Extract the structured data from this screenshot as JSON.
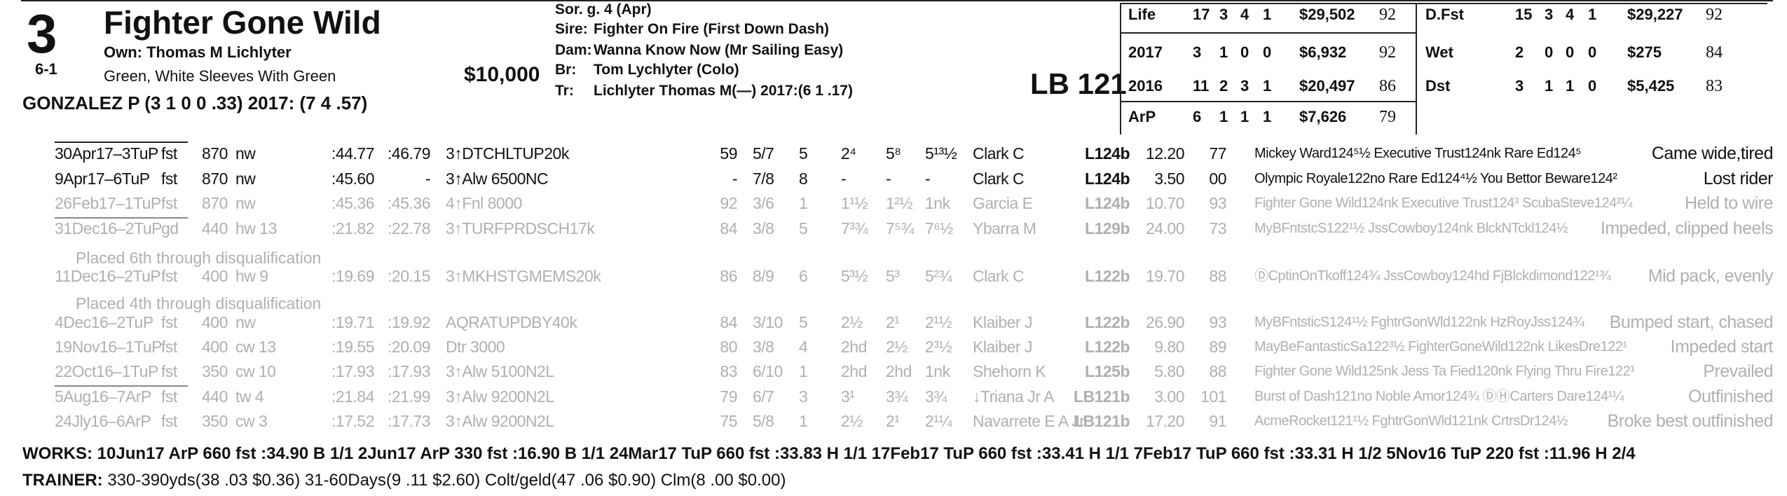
{
  "header": {
    "pp_number": "3",
    "horse_name": "Fighter Gone Wild",
    "owner": "Own: Thomas M Lichlyter",
    "morning_line": "6-1",
    "silks": "Green, White Sleeves With Green",
    "price": "$10,000",
    "jockey": "GONZALEZ P (3 1 0 0 .33) 2017: (7 4 .57)",
    "sex_age": "Sor. g. 4 (Apr)",
    "sire_label": "Sire:",
    "sire": "Fighter On Fire (First Down Dash)",
    "dam_label": "Dam:",
    "dam": "Wanna Know Now (Mr Sailing Easy)",
    "breeder_label": "Br:",
    "breeder": "Tom Lychlyter (Colo)",
    "trainer_label": "Tr:",
    "trainer": "Lichlyter Thomas M(—) 2017:(6 1 .17)",
    "lb": "LB 121"
  },
  "stats_left": [
    {
      "label": "Life",
      "starts": "17",
      "w": "3",
      "p": "4",
      "s": "1",
      "earn": "$29,502",
      "speed": "92"
    },
    {
      "label": "2017",
      "starts": "3",
      "w": "1",
      "p": "0",
      "s": "0",
      "earn": "$6,932",
      "speed": "92"
    },
    {
      "label": "2016",
      "starts": "11",
      "w": "2",
      "p": "3",
      "s": "1",
      "earn": "$20,497",
      "speed": "86"
    },
    {
      "label": "ArP",
      "starts": "6",
      "w": "1",
      "p": "1",
      "s": "1",
      "earn": "$7,626",
      "speed": "79"
    }
  ],
  "stats_right": [
    {
      "label": "D.Fst",
      "starts": "15",
      "w": "3",
      "p": "4",
      "s": "1",
      "earn": "$29,227",
      "speed": "92"
    },
    {
      "label": "Wet",
      "starts": "2",
      "w": "0",
      "p": "0",
      "s": "0",
      "earn": "$275",
      "speed": "84"
    },
    {
      "label": "Dst",
      "starts": "3",
      "w": "1",
      "p": "1",
      "s": "0",
      "earn": "$5,425",
      "speed": "83"
    }
  ],
  "races": [
    {
      "date": "30Apr17–3TuP",
      "cond": "fst",
      "dist": "870",
      "surf": "nw",
      "f1": ":44.77",
      "f2": ":46.79",
      "race": "3↑DTCHLTUP20k",
      "sp": "59",
      "pp": "5/7",
      "st": "5",
      "c1": "2⁴",
      "c2": "5⁸",
      "fin": "5¹³½",
      "jock": "Clark C",
      "wt": "L124b",
      "odds": "12.20",
      "fig": "77",
      "comment": "Mickey Ward124⁵½ Executive Trust124nk Rare Ed124⁵",
      "remark": "Came wide,tired",
      "faded": false
    },
    {
      "date": "9Apr17–6TuP",
      "cond": "fst",
      "dist": "870",
      "surf": "nw",
      "f1": ":45.60",
      "f2": "-",
      "race": "3↑Alw 6500NC",
      "sp": "-",
      "pp": "7/8",
      "st": "8",
      "c1": "-",
      "c2": "-",
      "fin": "-",
      "jock": "Clark C",
      "wt": "L124b",
      "odds": "3.50",
      "fig": "00",
      "comment": "Olympic Royale122no Rare Ed124⁴½ You Bettor Beware124²",
      "remark": "Lost rider",
      "faded": false
    },
    {
      "date": "26Feb17–1TuP",
      "cond": "fst",
      "dist": "870",
      "surf": "nw",
      "f1": ":45.36",
      "f2": ":45.36",
      "race": "4↑Fnl 8000",
      "sp": "92",
      "pp": "3/6",
      "st": "1",
      "c1": "1¹½",
      "c2": "1²½",
      "fin": "1nk",
      "jock": "Garcia E",
      "wt": "L124b",
      "odds": "10.70",
      "fig": "93",
      "comment": "Fighter Gone Wild124nk Executive Trust124³ ScubaSteve124²¼",
      "remark": "Held to wire",
      "faded": true
    },
    {
      "date": "31Dec16–2TuP",
      "cond": "gd",
      "dist": "440",
      "surf": "hw 13",
      "f1": ":21.82",
      "f2": ":22.78",
      "race": "3↑TURFPRDSCH17k",
      "sp": "84",
      "pp": "3/8",
      "st": "5",
      "c1": "7³¾",
      "c2": "7⁵¾",
      "fin": "7⁶½",
      "jock": "Ybarra M",
      "wt": "L129b",
      "odds": "24.00",
      "fig": "73",
      "comment": "MyBFntstcS122¹½ JssCowboy124nk BlckNTckl124½",
      "remark": "Impeded, clipped heels",
      "faded": true
    },
    {
      "date": "11Dec16–2TuP",
      "cond": "fst",
      "dist": "400",
      "surf": "hw 9",
      "f1": ":19.69",
      "f2": ":20.15",
      "race": "3↑MKHSTGMEMS20k",
      "sp": "86",
      "pp": "8/9",
      "st": "6",
      "c1": "5³½",
      "c2": "5³",
      "fin": "5²¾",
      "jock": "Clark C",
      "wt": "L122b",
      "odds": "19.70",
      "fig": "88",
      "comment": "ⒹCptinOnTkoff124¾ JssCowboy124hd FjBlckdimond122¹¾",
      "remark": "Mid pack, evenly",
      "faded": true
    },
    {
      "date": "4Dec16–2TuP",
      "cond": "fst",
      "dist": "400",
      "surf": "nw",
      "f1": ":19.71",
      "f2": ":19.92",
      "race": "AQRATUPDBY40k",
      "sp": "84",
      "pp": "3/10",
      "st": "5",
      "c1": "2½",
      "c2": "2¹",
      "fin": "2¹½",
      "jock": "Klaiber J",
      "wt": "L122b",
      "odds": "26.90",
      "fig": "93",
      "comment": "MyBFntsticS124¹½ FghtrGonWld122nk HzRoyJss124¾",
      "remark": "Bumped start, chased",
      "faded": true
    },
    {
      "date": "19Nov16–1TuP",
      "cond": "fst",
      "dist": "400",
      "surf": "cw 13",
      "f1": ":19.55",
      "f2": ":20.09",
      "race": "Dtr 3000",
      "sp": "80",
      "pp": "3/8",
      "st": "4",
      "c1": "2hd",
      "c2": "2½",
      "fin": "2³½",
      "jock": "Klaiber J",
      "wt": "L122b",
      "odds": "9.80",
      "fig": "89",
      "comment": "MayBeFantasticSa122³½ FighterGoneWild122nk LikesDre122¹",
      "remark": "Impeded start",
      "faded": true
    },
    {
      "date": "22Oct16–1TuP",
      "cond": "fst",
      "dist": "350",
      "surf": "cw 10",
      "f1": ":17.93",
      "f2": ":17.93",
      "race": "3↑Alw 5100N2L",
      "sp": "83",
      "pp": "6/10",
      "st": "1",
      "c1": "2hd",
      "c2": "2hd",
      "fin": "1nk",
      "jock": "Shehorn K",
      "wt": "L125b",
      "odds": "5.80",
      "fig": "88",
      "comment": "Fighter Gone Wild125nk Jess Ta Fied120nk Flying Thru Fire122¹",
      "remark": "Prevailed",
      "faded": true
    },
    {
      "date": "5Aug16–7ArP",
      "cond": "fst",
      "dist": "440",
      "surf": "tw 4",
      "f1": ":21.84",
      "f2": ":21.99",
      "race": "3↑Alw 9200N2L",
      "sp": "79",
      "pp": "6/7",
      "st": "3",
      "c1": "3¹",
      "c2": "3¾",
      "fin": "3¾",
      "jock": "↓Triana Jr A",
      "wt": "LB121b",
      "odds": "3.00",
      "fig": "101",
      "comment": "Burst of Dash121no Noble Amor124¾ ⒹⒽCarters Dare124¹¼",
      "remark": "Outfinished",
      "faded": true
    },
    {
      "date": "24Jly16–6ArP",
      "cond": "fst",
      "dist": "350",
      "surf": "cw 3",
      "f1": ":17.52",
      "f2": ":17.73",
      "race": "3↑Alw 9200N2L",
      "sp": "75",
      "pp": "5/8",
      "st": "1",
      "c1": "2½",
      "c2": "2¹",
      "fin": "2¹¼",
      "jock": "Navarrete E A Jr",
      "wt": "LB121b",
      "odds": "17.20",
      "fig": "91",
      "comment": "AcmeRocket121¹½ FghtrGonWld121nk CrtrsDr124½",
      "remark": "Broke best outfinished",
      "faded": true
    }
  ],
  "notes": {
    "dq1": "Placed 6th through disqualification",
    "dq2": "Placed 4th through disqualification"
  },
  "works": "WORKS:   10Jun17 ArP 660 fst :34.90 B 1/1  2Jun17 ArP 330 fst :16.90 B 1/1  24Mar17 TuP 660 fst :33.83 H 1/1  17Feb17 TuP 660 fst :33.41 H 1/1  7Feb17 TuP 660 fst :33.31 H 1/2  5Nov16 TuP 220 fst :11.96 H 2/4",
  "trainer_stats_label": "TRAINER:",
  "trainer_stats": "330-390yds(38 .03 $0.36) 31-60Days(9 .11 $2.60) Colt/geld(47 .06 $0.90) Clm(8 .00 $0.00)"
}
